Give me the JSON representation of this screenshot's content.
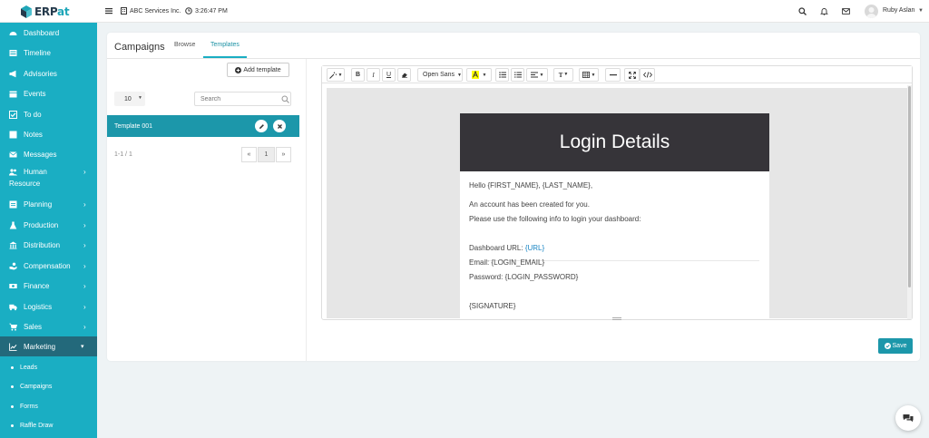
{
  "app": {
    "logo_text_1": "ERP",
    "logo_text_2": "at"
  },
  "topbar": {
    "company": "ABC Services Inc.",
    "time": "3:26:47 PM",
    "user_name": "Ruby Aslan"
  },
  "sidebar": {
    "items": [
      {
        "label": "Dashboard"
      },
      {
        "label": "Timeline"
      },
      {
        "label": "Advisories"
      },
      {
        "label": "Events"
      },
      {
        "label": "To do"
      },
      {
        "label": "Notes"
      },
      {
        "label": "Messages"
      },
      {
        "label": "Human"
      },
      {
        "label": "Resource"
      },
      {
        "label": "Planning"
      },
      {
        "label": "Production"
      },
      {
        "label": "Distribution"
      },
      {
        "label": "Compensation"
      },
      {
        "label": "Finance"
      },
      {
        "label": "Logistics"
      },
      {
        "label": "Sales"
      },
      {
        "label": "Marketing"
      }
    ],
    "sub_items": [
      {
        "label": "Leads"
      },
      {
        "label": "Campaigns"
      },
      {
        "label": "Forms"
      },
      {
        "label": "Raffle Draw"
      }
    ],
    "active_color": "#23697b",
    "bg_color": "#1aaec3"
  },
  "page": {
    "title": "Campaigns",
    "tabs": [
      {
        "label": "Browse"
      },
      {
        "label": "Templates"
      }
    ],
    "active_tab": "Templates"
  },
  "templates_panel": {
    "add_label": "Add template",
    "page_size": "10",
    "search_placeholder": "Search",
    "rows": [
      {
        "name": "Template 001"
      }
    ],
    "pagination_info": "1-1 / 1",
    "pager": {
      "prev": "«",
      "current": "1",
      "next": "»"
    }
  },
  "editor": {
    "toolbar": {
      "font_name": "Open Sans",
      "bold": "B",
      "italic": "I",
      "underline": "U",
      "font_size": "T"
    },
    "email": {
      "heading": "Login Details",
      "greeting": "Hello {FIRST_NAME},  {LAST_NAME},",
      "line1": "An account has been created for you.",
      "line2": "Please use the following info to login your dashboard:",
      "url_label": "Dashboard URL: ",
      "url_value": "{URL}",
      "email_line": "Email: {LOGIN_EMAIL}",
      "password_line": "Password: {LOGIN_PASSWORD}",
      "signature": "{SIGNATURE}"
    }
  },
  "actions": {
    "save_label": "Save"
  },
  "colors": {
    "accent": "#1aaec3",
    "button": "#1c97aa",
    "link": "#1b86c4",
    "email_header": "#363439"
  }
}
